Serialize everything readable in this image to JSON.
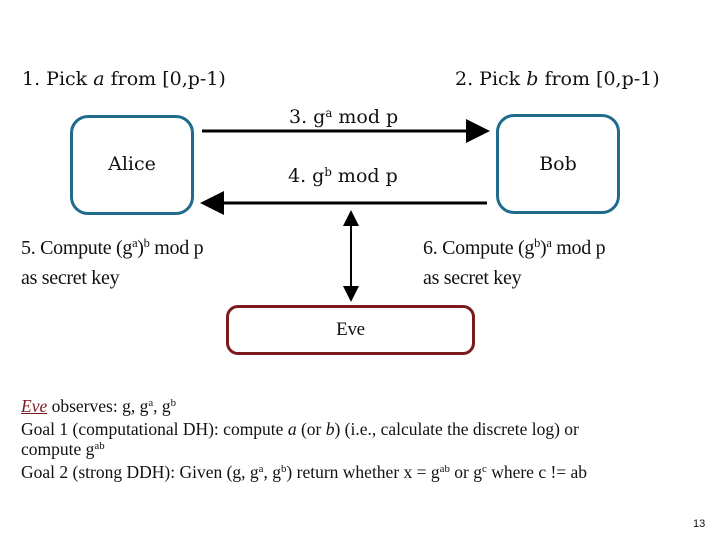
{
  "diagram": {
    "steps": {
      "step1": {
        "prefix": "1. Pick ",
        "var": "a",
        "suffix": " from [0,p-1)"
      },
      "step2": {
        "prefix": "2. Pick ",
        "var": "b",
        "suffix": " from [0,p-1)"
      },
      "step3": {
        "prefix": "3.  g",
        "sup": "a",
        "suffix": " mod p"
      },
      "step4": {
        "prefix": "4. g",
        "sup": "b",
        "suffix": " mod p"
      },
      "step5": {
        "line1_prefix": "5. Compute (g",
        "sup1": "a",
        "mid": ")",
        "sup2": "b",
        "line1_suffix": " mod p",
        "line2": "as secret key"
      },
      "step6": {
        "line1_prefix": "6. Compute (g",
        "sup1": "b",
        "mid": ")",
        "sup2": "a",
        "line1_suffix": " mod p",
        "line2": "as secret key"
      }
    },
    "nodes": {
      "alice": "Alice",
      "bob": "Bob",
      "eve": "Eve"
    },
    "colors": {
      "party_border": "#1f6b8c",
      "adversary_border": "#7a1a1f"
    }
  },
  "notes": {
    "line1": {
      "eve": "Eve",
      "text": " observes: g, g",
      "sup1": "a",
      "sep": ", g",
      "sup2": "b"
    },
    "line2": {
      "t1": "Goal 1 (computational DH): compute ",
      "a": "a",
      "t2": " (or ",
      "b": "b",
      "t3": ") (i.e., calculate the discrete log) or"
    },
    "line3": {
      "t1": "compute g",
      "sup": "ab"
    },
    "line4": {
      "t1": "Goal 2 (strong DDH): Given (g, g",
      "s1": "a",
      "t2": ", g",
      "s2": "b",
      "t3": ") return whether x = g",
      "s3": "ab",
      "t4": " or g",
      "s4": "c",
      "t5": " where c != ab"
    }
  },
  "page_number": "13"
}
